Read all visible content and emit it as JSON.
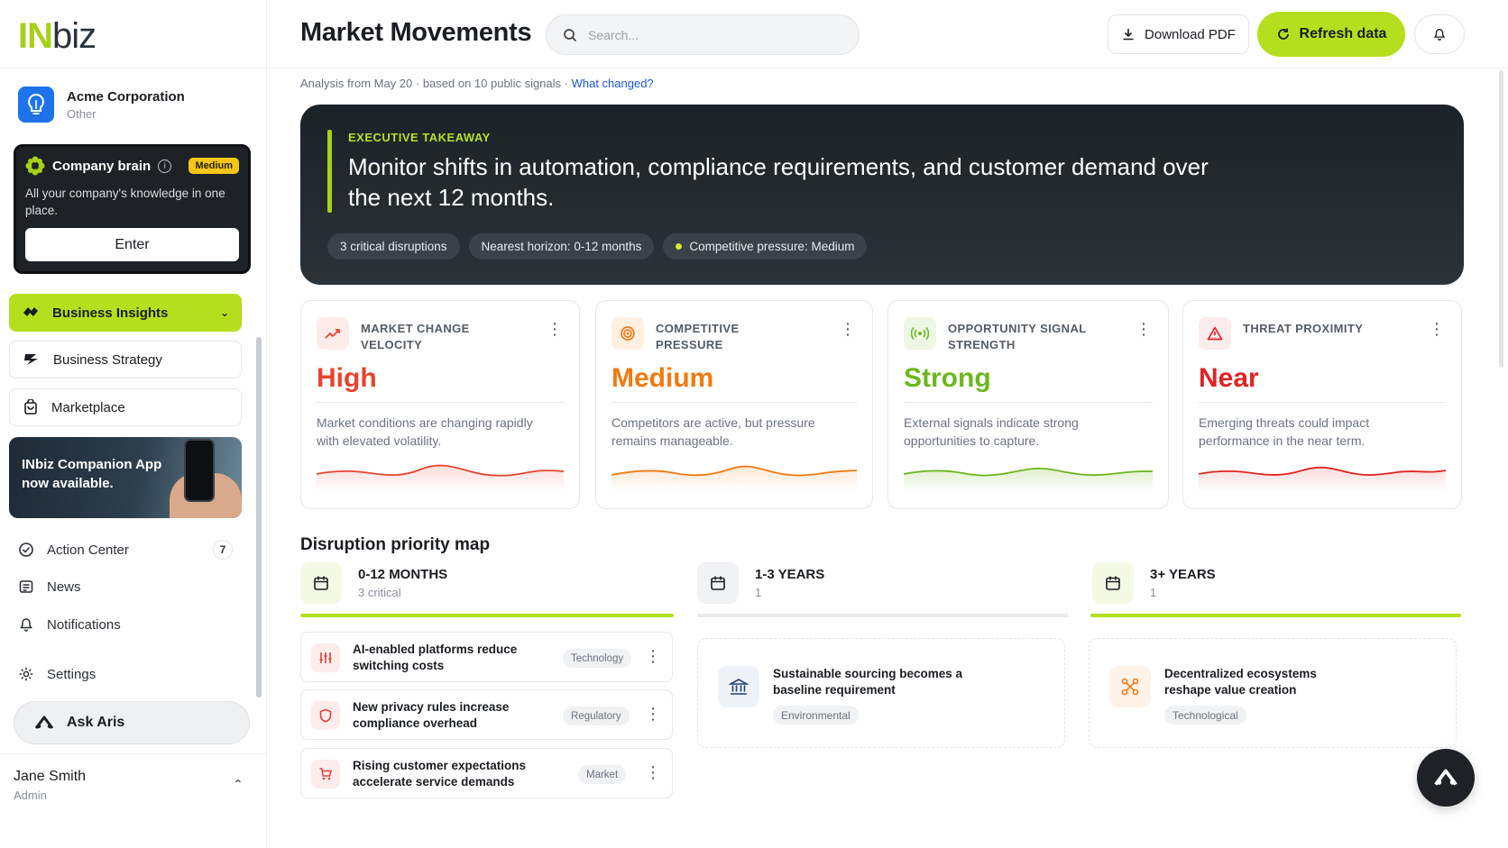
{
  "app": {
    "logo_in": "IN",
    "logo_biz": "biz"
  },
  "org": {
    "name": "Acme Corporation",
    "type": "Other"
  },
  "brain": {
    "title": "Company brain",
    "badge": "Medium",
    "desc": "All your company's knowledge in one place.",
    "enter": "Enter"
  },
  "nav": {
    "insights": "Business Insights",
    "strategy": "Business Strategy",
    "marketplace": "Marketplace",
    "promo": "INbiz Companion App now available.",
    "action_center": "Action Center",
    "action_count": "7",
    "news": "News",
    "notifications": "Notifications",
    "settings": "Settings",
    "ask": "Ask Aris"
  },
  "user": {
    "name": "Jane Smith",
    "role": "Admin"
  },
  "header": {
    "title": "Market Movements",
    "search_placeholder": "Search...",
    "download": "Download PDF",
    "refresh": "Refresh data"
  },
  "analysis": {
    "text": "Analysis from May 20 · based on 10 public signals · ",
    "link": "What changed?"
  },
  "executive": {
    "label": "EXECUTIVE TAKEAWAY",
    "title": "Monitor shifts in automation, compliance requirements, and customer demand over the next 12 months.",
    "chips": [
      "3 critical disruptions",
      "Nearest horizon: 0-12 months",
      "Competitive pressure: Medium"
    ]
  },
  "metrics": [
    {
      "label": "MARKET CHANGE VELOCITY",
      "value": "High",
      "desc": "Market conditions are changing rapidly with elevated volatility.",
      "color": "#e8432f"
    },
    {
      "label": "COMPETITIVE PRESSURE",
      "value": "Medium",
      "desc": "Competitors are active, but pressure remains manageable.",
      "color": "#f07a12"
    },
    {
      "label": "OPPORTUNITY SIGNAL STRENGTH",
      "value": "Strong",
      "desc": "External signals indicate strong opportunities to capture.",
      "color": "#6cb71e"
    },
    {
      "label": "THREAT PROXIMITY",
      "value": "Near",
      "desc": "Emerging threats could impact performance in the near term.",
      "color": "#e02424"
    }
  ],
  "disruption": {
    "title": "Disruption priority map",
    "columns": [
      {
        "title": "0-12 MONTHS",
        "sub": "3 critical"
      },
      {
        "title": "1-3 YEARS",
        "sub": "1"
      },
      {
        "title": "3+ YEARS",
        "sub": "1"
      }
    ],
    "near_items": [
      {
        "text": "AI-enabled platforms reduce switching costs",
        "tag": "Technology"
      },
      {
        "text": "New privacy rules increase compliance overhead",
        "tag": "Regulatory"
      },
      {
        "text": "Rising customer expectations accelerate service demands",
        "tag": "Market"
      }
    ],
    "mid_item": {
      "text": "Sustainable sourcing becomes a baseline requirement",
      "tag": "Environmental"
    },
    "far_item": {
      "text": "Decentralized ecosystems reshape value creation",
      "tag": "Technological"
    }
  }
}
